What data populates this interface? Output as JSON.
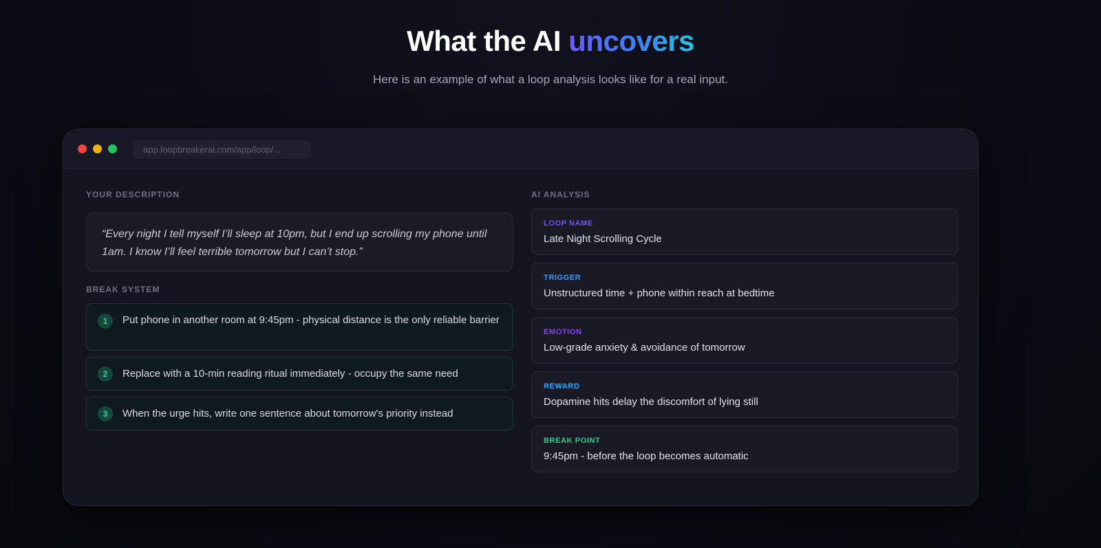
{
  "hero": {
    "title_main": "What the AI ",
    "title_accent": "uncovers",
    "subtitle": "Here is an example of what a loop analysis looks like for a real input."
  },
  "window": {
    "url": "app.loopbreakerai.com/app/loop/..."
  },
  "description": {
    "label": "YOUR DESCRIPTION",
    "quote": "“Every night I tell myself I’ll sleep at 10pm, but I end up scrolling my phone until 1am. I know I’ll feel terrible tomorrow but I can’t stop.”"
  },
  "break_system": {
    "label": "BREAK SYSTEM",
    "steps": [
      {
        "num": "1",
        "text": "Put phone in another room at 9:45pm - physical distance is the only reliable barrier"
      },
      {
        "num": "2",
        "text": "Replace with a 10-min reading ritual immediately - occupy the same need"
      },
      {
        "num": "3",
        "text": "When the urge hits, write one sentence about tomorrow's priority instead"
      }
    ]
  },
  "analysis": {
    "label": "AI ANALYSIS",
    "items": [
      {
        "label": "LOOP NAME",
        "value": "Late Night Scrolling Cycle",
        "color": "#7c4dff"
      },
      {
        "label": "TRIGGER",
        "value": "Unstructured time + phone within reach at bedtime",
        "color": "#3b9cff"
      },
      {
        "label": "EMOTION",
        "value": "Low-grade anxiety & avoidance of tomorrow",
        "color": "#8b3dff"
      },
      {
        "label": "REWARD",
        "value": "Dopamine hits delay the discomfort of lying still",
        "color": "#2aa6ff"
      },
      {
        "label": "BREAK POINT",
        "value": "9:45pm - before the loop becomes automatic",
        "color": "#22d38a"
      }
    ]
  },
  "colors": {
    "background": "#0b0b14",
    "window_bg": "#151521",
    "step_accent": "#34d399",
    "traffic_red": "#ef4444",
    "traffic_yellow": "#eab308",
    "traffic_green": "#22c55e"
  }
}
